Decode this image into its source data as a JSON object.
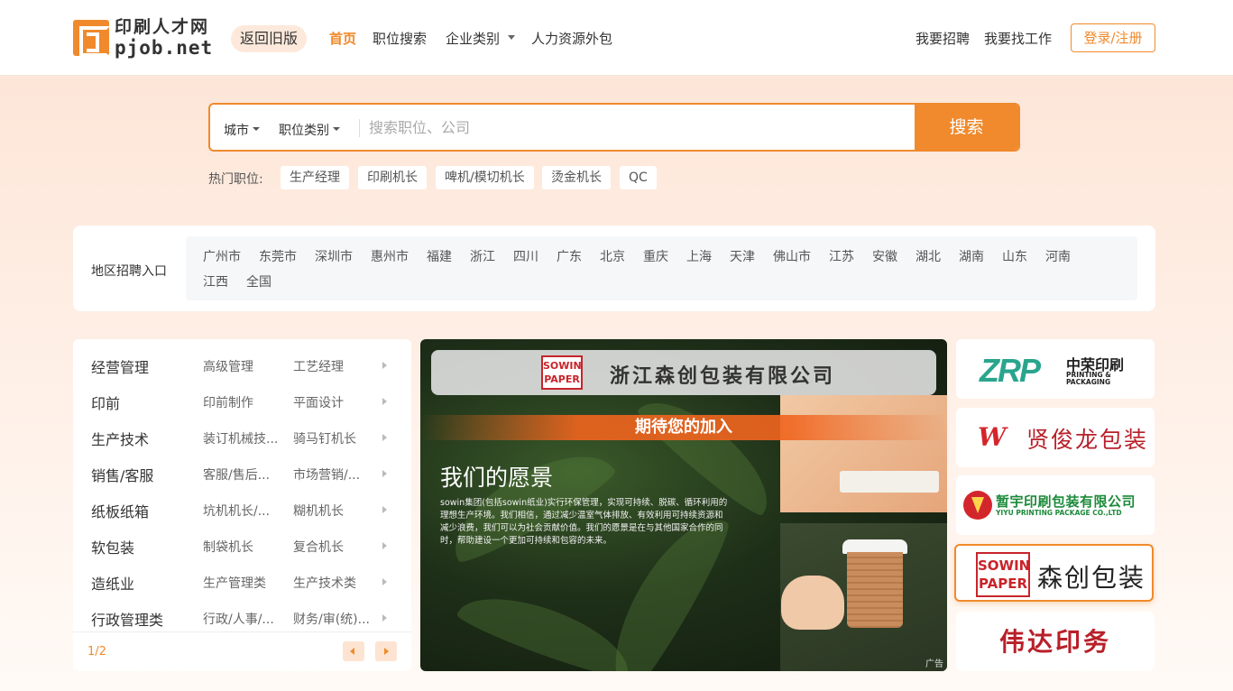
{
  "header": {
    "logo_cn": "印刷人才网",
    "logo_en": "pjob.net",
    "old_version": "返回旧版",
    "nav": [
      {
        "label": "首页",
        "active": true
      },
      {
        "label": "职位搜索"
      },
      {
        "label": "企业类别"
      },
      {
        "label": "人力资源外包"
      }
    ],
    "recruit": "我要招聘",
    "find_job": "我要找工作",
    "login": "登录/注册"
  },
  "search": {
    "city": "城市",
    "category": "职位类别",
    "placeholder": "搜索职位、公司",
    "button": "搜索",
    "hot_label": "热门职位:",
    "hot_tags": [
      "生产经理",
      "印刷机长",
      "啤机/模切机长",
      "烫金机长",
      "QC"
    ]
  },
  "region": {
    "label": "地区招聘入口",
    "items": [
      "广州市",
      "东莞市",
      "深圳市",
      "惠州市",
      "福建",
      "浙江",
      "四川",
      "广东",
      "北京",
      "重庆",
      "上海",
      "天津",
      "佛山市",
      "江苏",
      "安徽",
      "湖北",
      "湖南",
      "山东",
      "河南",
      "江西",
      "全国"
    ]
  },
  "categories": {
    "rows": [
      {
        "main": "经营管理",
        "sub1": "高级管理",
        "sub2": "工艺经理"
      },
      {
        "main": "印前",
        "sub1": "印前制作",
        "sub2": "平面设计"
      },
      {
        "main": "生产技术",
        "sub1": "装订机械技...",
        "sub2": "骑马钉机长"
      },
      {
        "main": "销售/客服",
        "sub1": "客服/售后...",
        "sub2": "市场营销/..."
      },
      {
        "main": "纸板纸箱",
        "sub1": "坑机机长/...",
        "sub2": "糊机机长"
      },
      {
        "main": "软包装",
        "sub1": "制袋机长",
        "sub2": "复合机长"
      },
      {
        "main": "造纸业",
        "sub1": "生产管理类",
        "sub2": "生产技术类"
      },
      {
        "main": "行政管理类",
        "sub1": "行政/人事/...",
        "sub2": "财务/审(统)..."
      }
    ],
    "page": "1/2"
  },
  "banner": {
    "sowin": "SOWIN PAPER",
    "company": "浙江森创包装有限公司",
    "join": "期待您的加入",
    "vision_title": "我们的愿景",
    "vision_body": "sowin集团(包括sowin纸业)实行环保管理，实现可持续、脱碳、循环利用的理想生产环境。我们相信，通过减少温室气体排放、有效利用可持续资源和减少浪费，我们可以为社会贡献价值。我们的愿景是在与其他国家合作的同时，帮助建设一个更加可持续和包容的未来。",
    "ad": "广告"
  },
  "sponsors": {
    "zrp_mark": "ZRP",
    "zrp_cn": "中荣印刷",
    "zrp_en": "PRINTING & PACKAGING",
    "xjl_mark": "W",
    "xjl": "贤俊龙包装",
    "yiyu_cn": "暂宇印刷包装有限公司",
    "yiyu_en": "YIYU PRINTING PACKAGE CO.,LTD",
    "sowin": "SOWIN PAPER",
    "sowin_cn": "森创包装",
    "weida": "伟达印务"
  },
  "colors": {
    "accent": "#f08a2c",
    "hero_bg": "#fde6d8"
  }
}
